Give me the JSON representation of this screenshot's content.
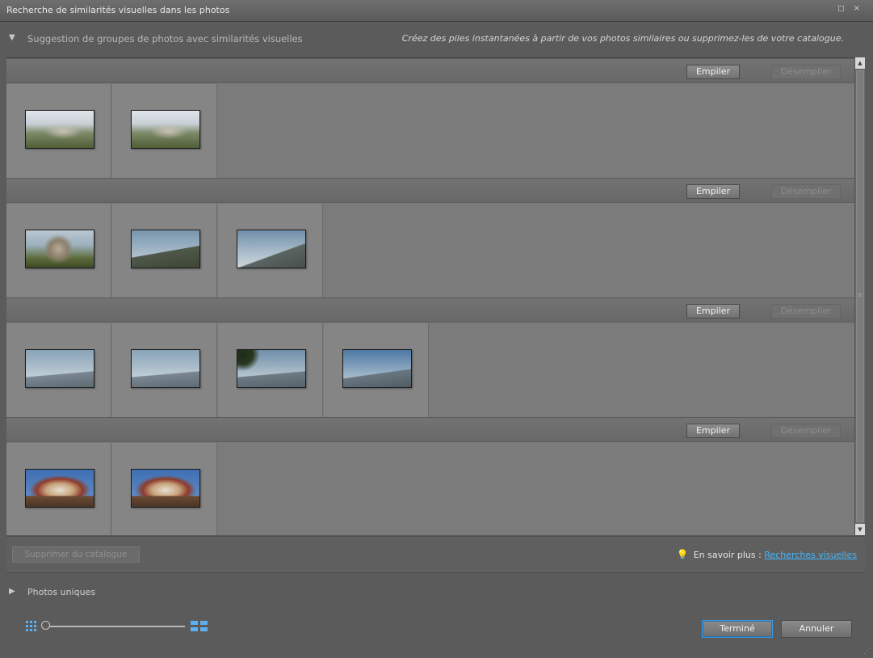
{
  "window": {
    "title": "Recherche de similarités visuelles dans les photos",
    "controls": "◻ ×"
  },
  "suggestions": {
    "label": "Suggestion de groupes de photos avec similarités visuelles",
    "hint": "Créez des piles instantanées à partir de vos photos similaires ou supprimez-les de votre catalogue."
  },
  "groups": [
    {
      "stack_label": "Empiler",
      "unstack_label": "Désempiler",
      "thumbnails": [
        "hill-town",
        "hill-town"
      ]
    },
    {
      "stack_label": "Empiler",
      "unstack_label": "Désempiler",
      "thumbnails": [
        "stupa",
        "mountain-view",
        "mountain-view"
      ]
    },
    {
      "stack_label": "Empiler",
      "unstack_label": "Désempiler",
      "thumbnails": [
        "mountain-range",
        "mountain-range",
        "mountain-range-tree",
        "mountain-range"
      ]
    },
    {
      "stack_label": "Empiler",
      "unstack_label": "Désempiler",
      "thumbnails": [
        "temple",
        "temple"
      ]
    }
  ],
  "footer": {
    "remove_label": "Supprimer du catalogue",
    "learn_more_prefix": "En savoir plus : ",
    "learn_more_link": "Recherches visuelles"
  },
  "unique_photos": {
    "label": "Photos uniques"
  },
  "zoom": {
    "level": 0
  },
  "actions": {
    "done_label": "Terminé",
    "cancel_label": "Annuler"
  },
  "colors": {
    "accent": "#3fb8ff",
    "panel": "#7b7b7b",
    "background": "#5b5b5b"
  }
}
